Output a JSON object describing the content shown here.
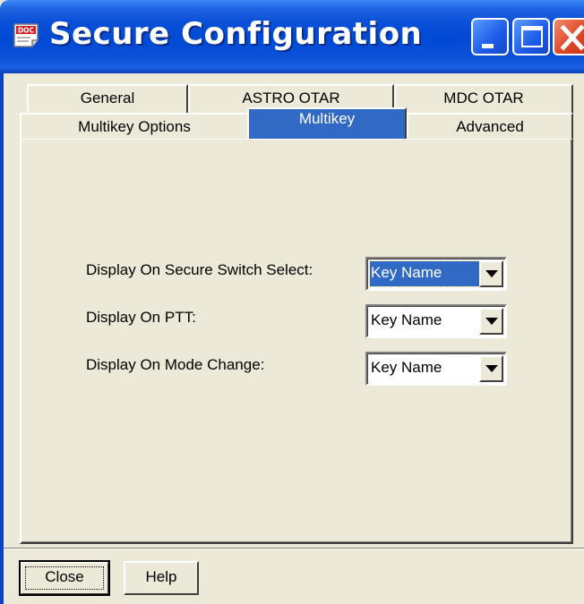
{
  "window": {
    "title": "Secure Configuration",
    "icon": "document-icon",
    "title_color": "#ffffff",
    "titlebar_color": "#0a4fd7",
    "controls": {
      "minimize_icon": "minimize-icon",
      "maximize_icon": "maximize-icon",
      "close_icon": "close-icon"
    }
  },
  "tabs": {
    "back_row": [
      "General",
      "ASTRO OTAR",
      "MDC OTAR"
    ],
    "front_row": [
      "Multikey Options",
      "Multikey",
      "Advanced"
    ],
    "active": "Multikey",
    "active_color": "#316ac5"
  },
  "form": {
    "fields": [
      {
        "label": "Display On Secure Switch Select:",
        "value": "Key Name",
        "focused": true
      },
      {
        "label": "Display On PTT:",
        "value": "Key Name",
        "focused": false
      },
      {
        "label": "Display On Mode Change:",
        "value": "Key Name",
        "focused": false
      }
    ],
    "dropdown_icon": "chevron-down-icon"
  },
  "buttons": {
    "close_label": "Close",
    "help_label": "Help"
  },
  "colors": {
    "dialog_background": "#ece9d8",
    "selection": "#316ac5"
  }
}
